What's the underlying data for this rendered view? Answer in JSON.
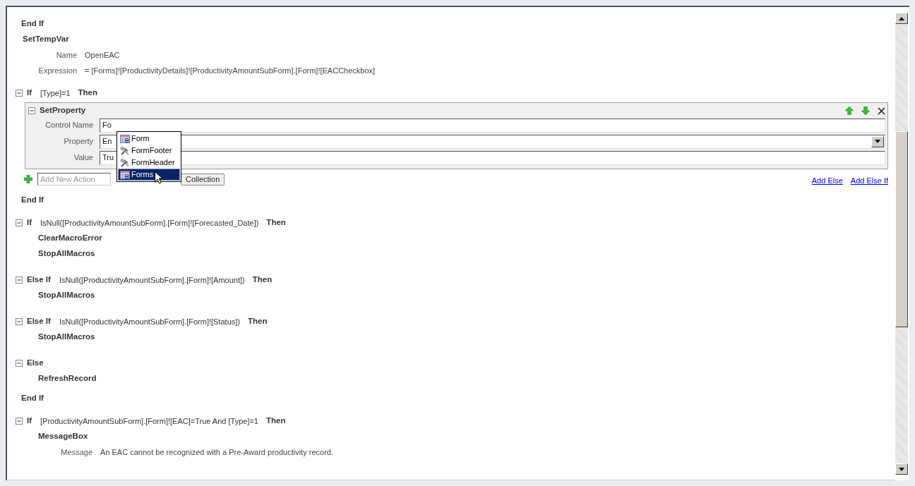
{
  "macro": [
    {
      "kind": "end",
      "label": "End If"
    },
    {
      "kind": "action",
      "name": "SetTempVar",
      "arguments": [
        {
          "label": "Name",
          "value": "OpenEAC"
        },
        {
          "label": "Expression",
          "value": "= [Forms]![ProductivityDetails]![ProductivityAmountSubForm].[Form]![EACCheckbox]"
        }
      ]
    },
    {
      "kind": "if_block",
      "branches": [
        {
          "keyword": "If",
          "condition": "[Type]=1",
          "then": "Then",
          "expanded": true,
          "actions": [
            {
              "kind": "editor",
              "name": "SetProperty",
              "expanded": true,
              "fields": [
                {
                  "kind": "text",
                  "label": "Control Name",
                  "value": "Fo",
                  "autocomplete": {
                    "items": [
                      {
                        "kind": "form",
                        "label": "Form",
                        "selected": false
                      },
                      {
                        "kind": "section",
                        "label": "FormFooter",
                        "selected": false
                      },
                      {
                        "kind": "section",
                        "label": "FormHeader",
                        "selected": false
                      },
                      {
                        "kind": "form",
                        "label": "Forms",
                        "selected": true
                      }
                    ]
                  }
                },
                {
                  "kind": "select",
                  "label": "Property",
                  "value": "En"
                },
                {
                  "kind": "text",
                  "label": "Value",
                  "value": "Tru"
                }
              ]
            }
          ],
          "add_action": {
            "placeholder": "Add New Action",
            "button": "Collection"
          },
          "links": [
            "Add Else",
            "Add Else If"
          ]
        }
      ],
      "end": "End If"
    },
    {
      "kind": "if_block",
      "branches": [
        {
          "keyword": "If",
          "condition": "IsNull([ProductivityAmountSubForm].[Form]![Forecasted_Date])",
          "then": "Then",
          "expanded": true,
          "actions": [
            {
              "kind": "action",
              "name": "ClearMacroError"
            },
            {
              "kind": "action",
              "name": "StopAllMacros"
            }
          ]
        },
        {
          "keyword": "Else If",
          "condition": "IsNull([ProductivityAmountSubForm].[Form]![Amount])",
          "then": "Then",
          "expanded": true,
          "actions": [
            {
              "kind": "action",
              "name": "StopAllMacros"
            }
          ]
        },
        {
          "keyword": "Else If",
          "condition": "IsNull([ProductivityAmountSubForm].[Form]![Status])",
          "then": "Then",
          "expanded": true,
          "actions": [
            {
              "kind": "action",
              "name": "StopAllMacros"
            }
          ]
        },
        {
          "keyword": "Else",
          "expanded": true,
          "actions": [
            {
              "kind": "action",
              "name": "RefreshRecord"
            }
          ]
        }
      ],
      "end": "End If"
    },
    {
      "kind": "if_block",
      "branches": [
        {
          "keyword": "If",
          "condition": "[ProductivityAmountSubForm].[Form]![EAC]=True And [Type]=1",
          "then": "Then",
          "expanded": true,
          "actions": [
            {
              "kind": "action",
              "name": "MessageBox",
              "arguments": [
                {
                  "label": "Message",
                  "value": "An EAC cannot be recognized with a Pre-Award productivity record."
                }
              ]
            }
          ]
        }
      ]
    }
  ]
}
